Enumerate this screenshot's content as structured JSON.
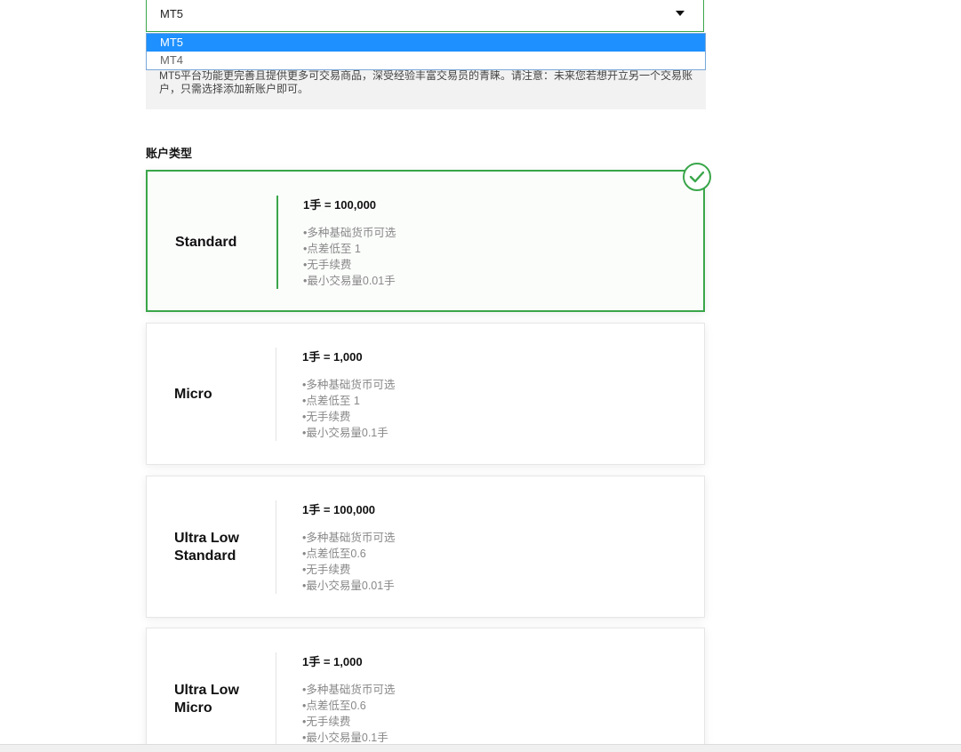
{
  "platform": {
    "selected": "MT5",
    "options": [
      "MT5",
      "MT4"
    ],
    "description": "MT5平台功能更完善且提供更多可交易商品，深受经验丰富交易员的青睐。请注意：未来您若想开立另一个交易账户，只需选择添加新账户即可。"
  },
  "account_type_title": "账户类型",
  "accounts": [
    {
      "name_lines": [
        "Standard",
        ""
      ],
      "lot": "1手 = 100,000",
      "features": [
        "•多种基础货币可选",
        "•点差低至 1",
        "•无手续费",
        "•最小交易量0.01手"
      ],
      "selected": true
    },
    {
      "name_lines": [
        "Micro",
        ""
      ],
      "lot": "1手 = 1,000",
      "features": [
        "•多种基础货币可选",
        "•点差低至 1",
        "•无手续费",
        "•最小交易量0.1手"
      ],
      "selected": false
    },
    {
      "name_lines": [
        "Ultra Low",
        "Standard"
      ],
      "lot": "1手 = 100,000",
      "features": [
        "•多种基础货币可选",
        "•点差低至0.6",
        "•无手续费",
        "•最小交易量0.01手"
      ],
      "selected": false
    },
    {
      "name_lines": [
        "Ultra Low",
        "Micro"
      ],
      "lot": "1手 = 1,000",
      "features": [
        "•多种基础货币可选",
        "•点差低至0.6",
        "•无手续费",
        "•最小交易量0.1手"
      ],
      "selected": false
    }
  ],
  "colors": {
    "accent_green": "#3aa64a",
    "dropdown_highlight": "#1e90ff"
  },
  "icons": {
    "check": "check-circle-icon",
    "caret": "caret-down-icon"
  }
}
